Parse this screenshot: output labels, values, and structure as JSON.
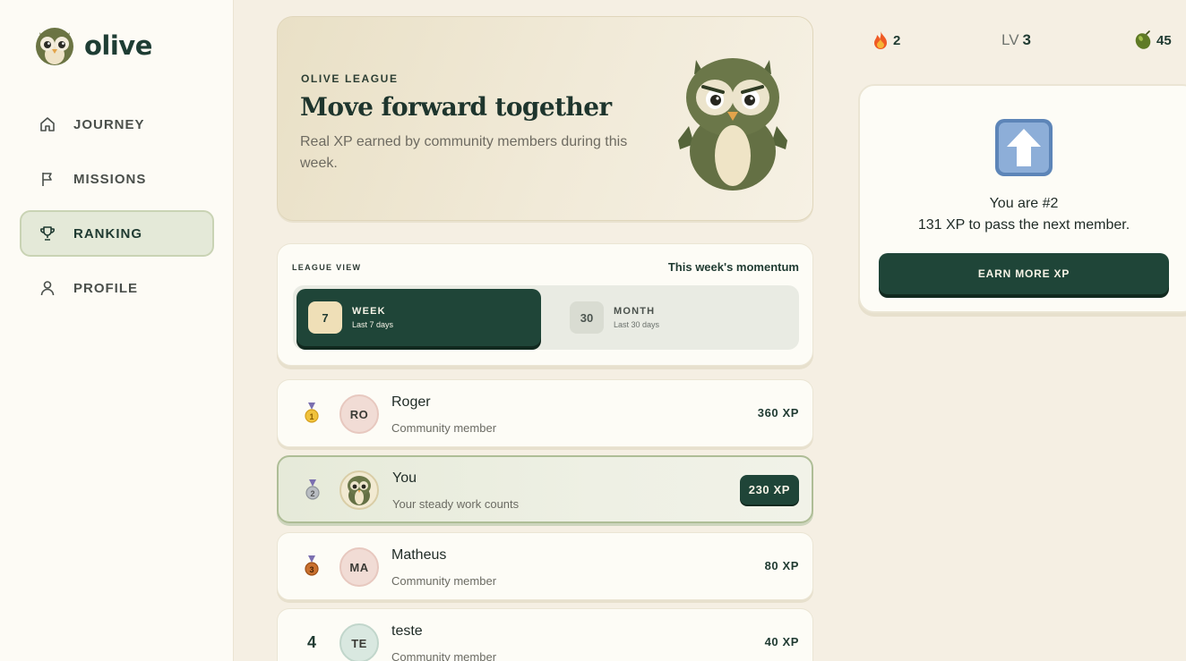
{
  "brand": {
    "name": "olive"
  },
  "nav": [
    {
      "label": "JOURNEY",
      "icon": "home-icon",
      "active": false
    },
    {
      "label": "MISSIONS",
      "icon": "flag-icon",
      "active": false
    },
    {
      "label": "RANKING",
      "icon": "trophy-icon",
      "active": true
    },
    {
      "label": "PROFILE",
      "icon": "user-icon",
      "active": false
    }
  ],
  "hero": {
    "eyebrow": "OLIVE LEAGUE",
    "title": "Move forward together",
    "subtitle": "Real XP earned by community members during this week."
  },
  "league": {
    "label": "LEAGUE VIEW",
    "momentum": "This week's momentum",
    "options": [
      {
        "num": "7",
        "title": "WEEK",
        "desc": "Last 7 days",
        "selected": true
      },
      {
        "num": "30",
        "title": "MONTH",
        "desc": "Last 30 days",
        "selected": false
      }
    ]
  },
  "ranking": [
    {
      "rank": "1",
      "medal": "gold-medal-icon",
      "initials": "RO",
      "name": "Roger",
      "sub": "Community member",
      "xp": "360 XP",
      "me": false,
      "avatar_bg": "#f1dcd5",
      "avatar_border": "#e7c8bf"
    },
    {
      "rank": "2",
      "medal": "silver-medal-icon",
      "initials": "",
      "name": "You",
      "sub": "Your steady work counts",
      "xp": "230 XP",
      "me": true,
      "avatar_bg": "#f2ead2",
      "avatar_border": "#d9cda6"
    },
    {
      "rank": "3",
      "medal": "bronze-medal-icon",
      "initials": "MA",
      "name": "Matheus",
      "sub": "Community member",
      "xp": "80 XP",
      "me": false,
      "avatar_bg": "#f1dcd5",
      "avatar_border": "#e7c8bf"
    },
    {
      "rank": "4",
      "medal": "",
      "initials": "TE",
      "name": "teste",
      "sub": "Community member",
      "xp": "40 XP",
      "me": false,
      "avatar_bg": "#d9e8e0",
      "avatar_border": "#c1d6cb"
    }
  ],
  "stats": {
    "streak": "2",
    "level_label": "LV",
    "level": "3",
    "olives": "45"
  },
  "side": {
    "line1": "You are #2",
    "line2": "131 XP to pass the next member.",
    "button": "EARN MORE XP"
  },
  "colors": {
    "accent": "#1f4538",
    "background": "#f5efe3",
    "sidebar": "#fdfbf5",
    "active_nav": "#e4e9d8"
  }
}
